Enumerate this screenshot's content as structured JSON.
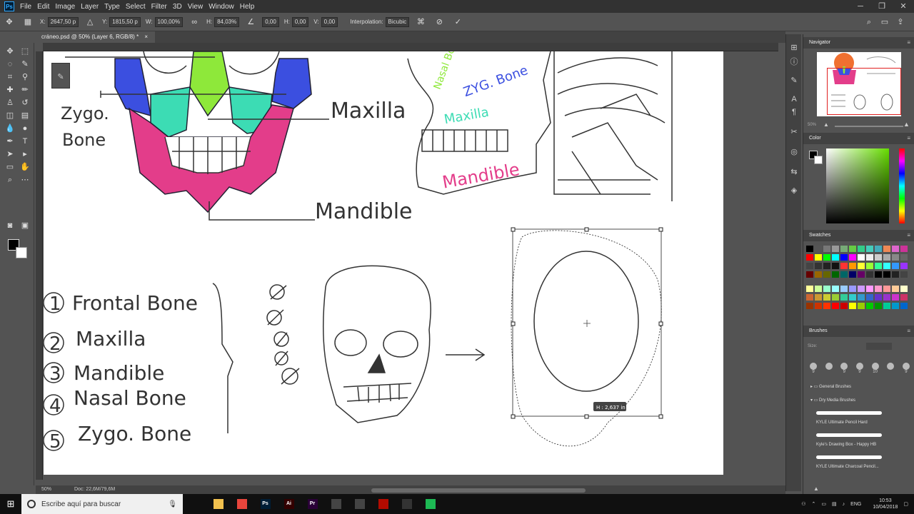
{
  "app": {
    "menu": [
      "File",
      "Edit",
      "Image",
      "Layer",
      "Type",
      "Select",
      "Filter",
      "3D",
      "View",
      "Window",
      "Help"
    ]
  },
  "options": {
    "x_label": "X:",
    "x_value": "2647,50 p",
    "y_label": "Y:",
    "y_value": "1815,50 p",
    "w_label": "W:",
    "w_value": "100,00%",
    "h_label": "H:",
    "h_value": "84,03%",
    "angle_value": "0,00",
    "hskew_label": "H:",
    "hskew_value": "0,00",
    "vskew_label": "V:",
    "vskew_value": "0,00",
    "interp_label": "Interpolation:",
    "interp_value": "Bicubic"
  },
  "document": {
    "tab_title": "cráneo.psd @ 50% (Layer 6, RGB/8) *"
  },
  "canvas": {
    "labels": {
      "maxilla": "Maxilla",
      "mandible": "Mandible",
      "zygo_line1": "Zygo.",
      "zygo_line2": "Bone",
      "side_nasal": "Nasal Bone",
      "side_zygo": "ZYG. Bone",
      "side_maxilla": "Maxilla",
      "side_mandible": "Mandible"
    },
    "list": [
      {
        "num": "1",
        "text": "Frontal Bone"
      },
      {
        "num": "2",
        "text": "Maxilla"
      },
      {
        "num": "3",
        "text": "Mandible"
      },
      {
        "num": "4",
        "text": "Nasal Bone"
      },
      {
        "num": "5",
        "text": "Zygo. Bone"
      }
    ],
    "transform_tooltip": "H : 2,637 in"
  },
  "status": {
    "zoom": "50%",
    "doc": "Doc: 22,6M/79,6M"
  },
  "panels": {
    "navigator": "Navigator",
    "nav_zoom": "50%",
    "color": "Color",
    "swatches": "Swatches",
    "brushes": "Brushes",
    "brush_size_label": "Size:",
    "brush_tip_sizes": [
      "9",
      "9",
      "9",
      "10",
      "9"
    ],
    "brush_groups": [
      "General Brushes",
      "Dry Media Brushes"
    ],
    "brush_items": [
      "KYLE Ultimate Pencil Hard",
      "Kyle's Drawing Box - Happy HB",
      "KYLE Ultimate Charcoal Pencil..."
    ]
  },
  "taskbar": {
    "search_placeholder": "Escribe aquí para buscar",
    "apps": [
      {
        "name": "task-view",
        "label": "",
        "color": "#101010"
      },
      {
        "name": "file-explorer",
        "label": "",
        "color": "#f2c14e"
      },
      {
        "name": "chrome",
        "label": "",
        "color": "#e8453c"
      },
      {
        "name": "photoshop",
        "label": "Ps",
        "color": "#001e36"
      },
      {
        "name": "illustrator",
        "label": "Ai",
        "color": "#330000"
      },
      {
        "name": "premiere",
        "label": "Pr",
        "color": "#2a0038"
      },
      {
        "name": "app-generic-1",
        "label": "",
        "color": "#444444"
      },
      {
        "name": "app-generic-2",
        "label": "",
        "color": "#444444"
      },
      {
        "name": "acrobat",
        "label": "",
        "color": "#b30b00"
      },
      {
        "name": "app-generic-3",
        "label": "",
        "color": "#333333"
      },
      {
        "name": "spotify",
        "label": "",
        "color": "#1db954"
      }
    ],
    "language": "ENG",
    "time": "10:53",
    "date": "10/04/2018"
  },
  "colors": {
    "maxilla_fill": "#3cdcb4",
    "zygo_fill": "#3b4fe0",
    "nasal_fill": "#8ee83a",
    "mandible_fill": "#e33d8a"
  }
}
